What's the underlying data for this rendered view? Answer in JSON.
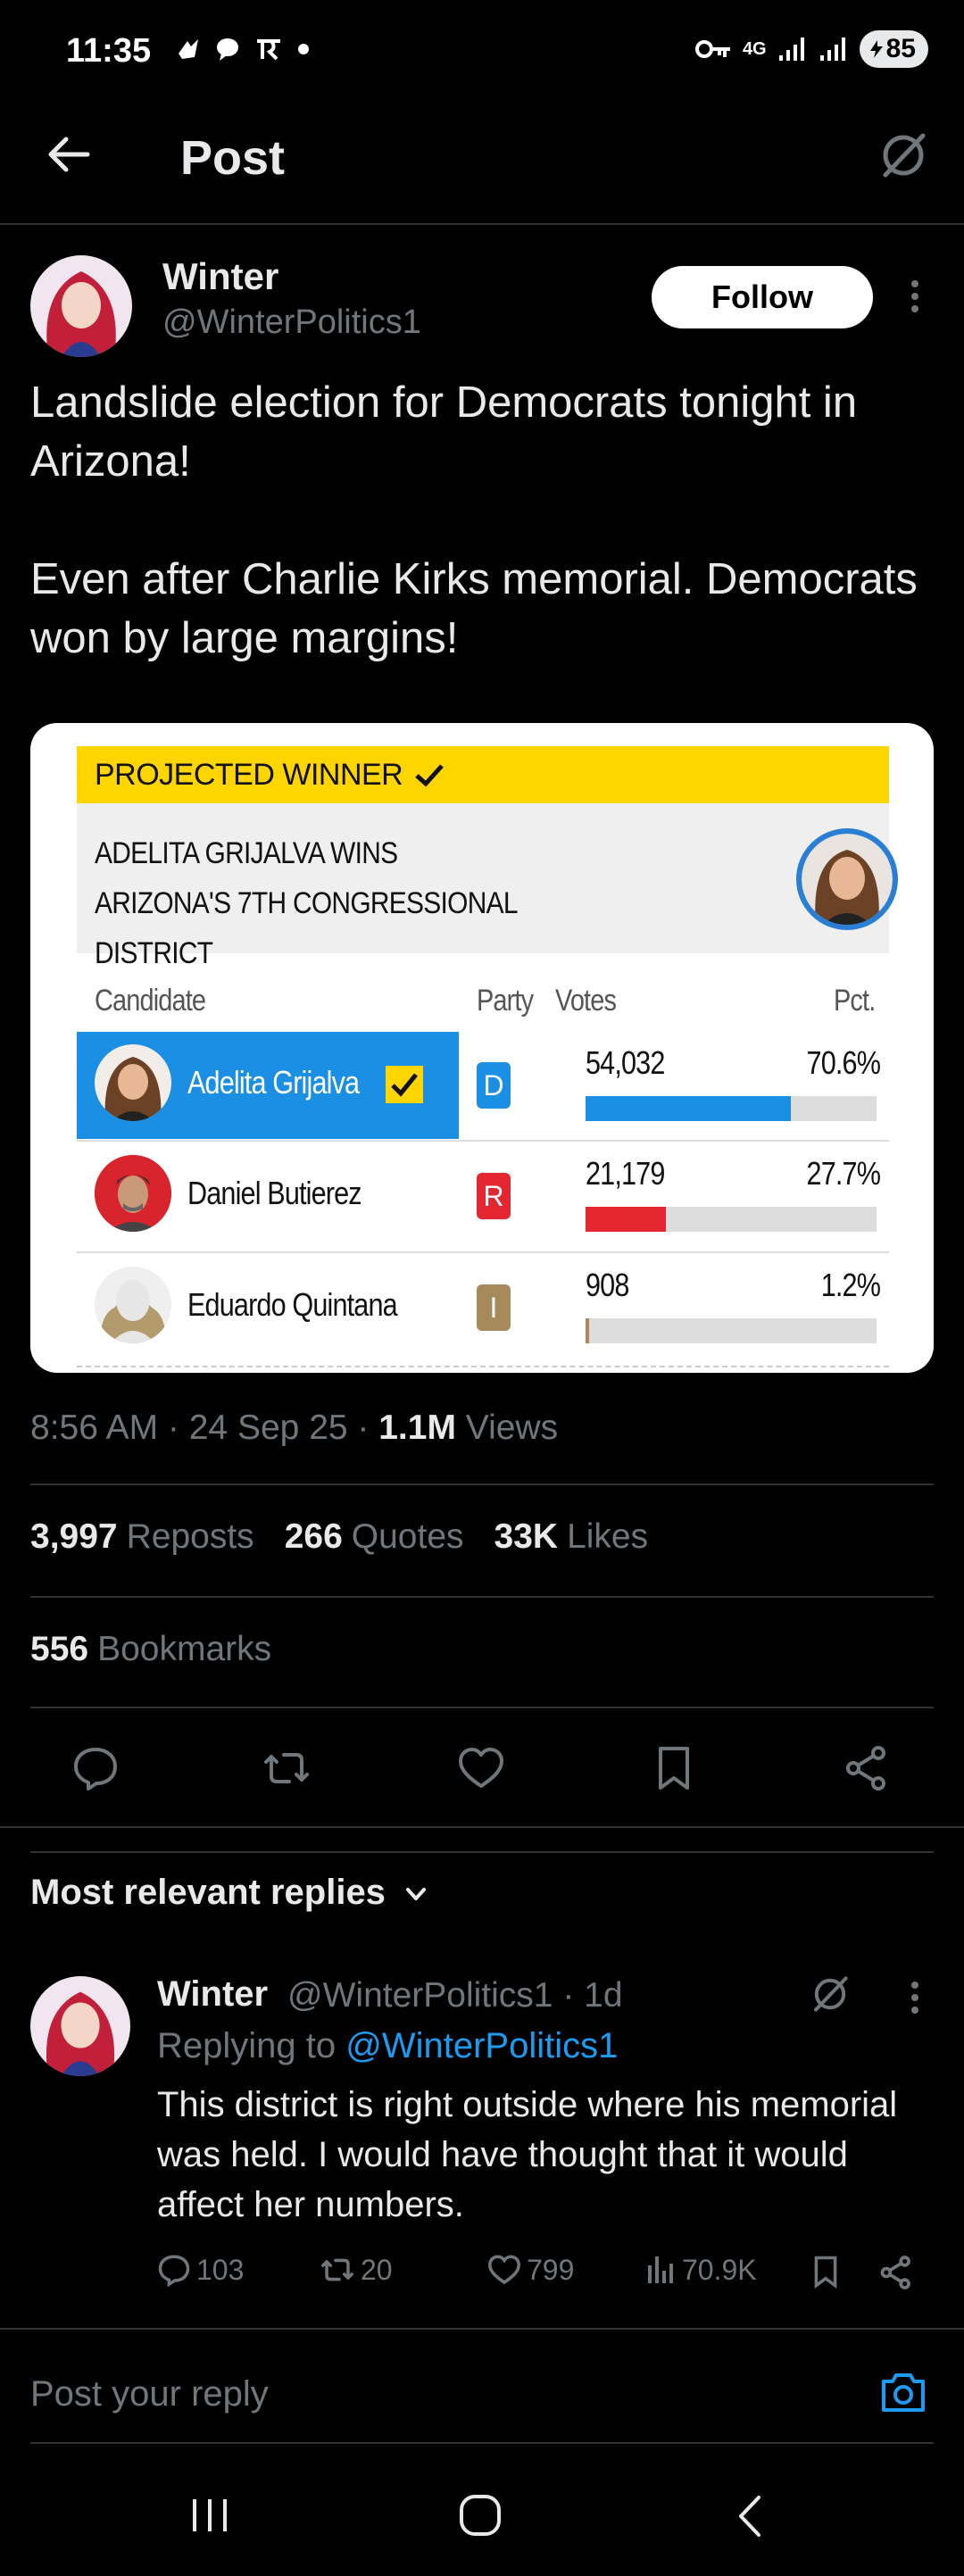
{
  "status_bar": {
    "time": "11:35",
    "network": "4G",
    "battery": "85",
    "icons": [
      "app-notification-icon",
      "chat-icon",
      "payments-icon",
      "dot-icon",
      "vpn-key-icon",
      "signal-icon",
      "signal-icon",
      "battery-icon"
    ]
  },
  "header": {
    "title": "Post"
  },
  "post": {
    "author_name": "Winter",
    "author_handle": "@WinterPolitics1",
    "follow_label": "Follow",
    "text": "Landslide election for Democrats tonight in Arizona!\n\nEven after Charlie Kirks memorial. Democrats won by large margins!",
    "timestamp": "8:56 AM · 24 Sep 25 · ",
    "views_count": "1.1M",
    "views_label": " Views"
  },
  "card": {
    "banner": "PROJECTED WINNER",
    "headline": "ADELITA GRIJALVA WINS ARIZONA'S 7TH CONGRESSIONAL DISTRICT",
    "columns": {
      "candidate": "Candidate",
      "party": "Party",
      "votes": "Votes",
      "pct": "Pct."
    },
    "rows": [
      {
        "name": "Adelita Grijalva",
        "party": "D",
        "votes": "54,032",
        "pct": "70.6%",
        "share": 0.706,
        "winner": true
      },
      {
        "name": "Daniel Butierez",
        "party": "R",
        "votes": "21,179",
        "pct": "27.7%",
        "share": 0.277,
        "winner": false
      },
      {
        "name": "Eduardo Quintana",
        "party": "I",
        "votes": "908",
        "pct": "1.2%",
        "share": 0.012,
        "winner": false
      }
    ],
    "colors": {
      "D": "#1a8fe3",
      "R": "#e3262f",
      "I": "#a78a5b",
      "winner_bg": "#1a8fe3",
      "banner": "#ffd500"
    }
  },
  "stats": {
    "reposts_count": "3,997",
    "reposts_label": "Reposts",
    "quotes_count": "266",
    "quotes_label": "Quotes",
    "likes_count": "33K",
    "likes_label": "Likes",
    "bookmarks_count": "556",
    "bookmarks_label": "Bookmarks"
  },
  "replies": {
    "section_title": "Most relevant replies",
    "items": [
      {
        "name": "Winter",
        "handle_time": "@WinterPolitics1 · 1d",
        "replying_prefix": "Replying to ",
        "replying_to": "@WinterPolitics1",
        "text": "This district is right outside where his memorial was held. I would have thought that it would affect her numbers.",
        "replies": "103",
        "reposts": "20",
        "likes": "799",
        "views": "70.9K"
      }
    ]
  },
  "compose": {
    "placeholder": "Post your reply"
  }
}
